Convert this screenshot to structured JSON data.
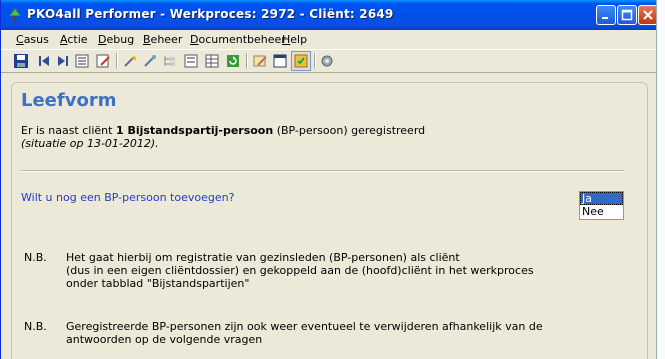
{
  "window": {
    "title": "PKO4all Performer - Werkproces: 2972 - Cliënt: 2649"
  },
  "menu": [
    {
      "label": "Casus",
      "accel": "C",
      "rest": "asus"
    },
    {
      "label": "Actie",
      "accel": "A",
      "rest": "ctie"
    },
    {
      "label": "Debug",
      "accel": "D",
      "rest": "ebug"
    },
    {
      "label": "Beheer",
      "accel": "B",
      "rest": "eheer"
    },
    {
      "label": "Documentbeheer",
      "accel": "D",
      "rest": "ocumentbeheer"
    },
    {
      "label": "Help",
      "accel": "H",
      "rest": "elp"
    }
  ],
  "toolbar_icons": [
    "save-icon",
    "first-record-icon",
    "last-record-icon",
    "list-icon",
    "edit-icon",
    "wand-icon",
    "wand-alt-icon",
    "tree-icon",
    "form-icon",
    "table-icon",
    "refresh-icon",
    "pencil-note-icon",
    "window-icon",
    "checklist-icon",
    "settings-icon"
  ],
  "content": {
    "heading": "Leefvorm",
    "intro_prefix": "Er is naast cliënt ",
    "intro_bold": "1 Bijstandspartij-persoon",
    "intro_suffix": " (BP-persoon) geregistreerd",
    "situation": "(situatie op 13-01-2012).",
    "question": "Wilt u nog een BP-persoon toevoegen?",
    "options": [
      "Ja",
      "Nee"
    ],
    "selected_option": "Ja",
    "notes": [
      {
        "label": "N.B.",
        "lines": [
          "Het gaat hierbij om registratie van gezinsleden (BP-personen) als cliënt",
          "(dus in een eigen cliëntdossier) en gekoppeld aan de (hoofd)cliënt in het werkproces",
          "onder tabblad \"Bijstandspartijen\""
        ]
      },
      {
        "label": "N.B.",
        "lines": [
          "Geregistreerde BP-personen zijn ook weer eventueel te verwijderen afhankelijk van de",
          "antwoorden op de volgende vragen"
        ]
      }
    ]
  },
  "colors": {
    "titlebar": "#0050EE",
    "heading": "#3E70C4",
    "question": "#1E3CC8",
    "selection": "#316AC5"
  }
}
